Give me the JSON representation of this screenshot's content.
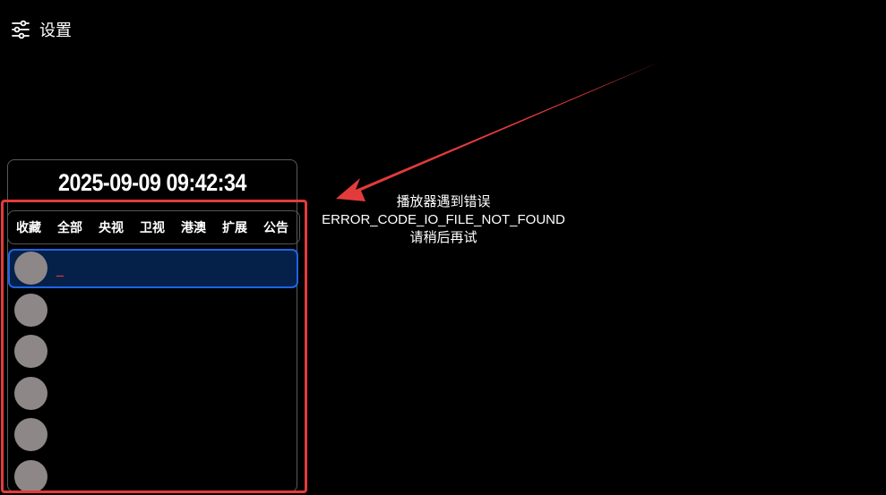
{
  "settings": {
    "icon": "sliders-icon",
    "label": "设置"
  },
  "clock": {
    "datetime": "2025-09-09 09:42:34"
  },
  "tabs": [
    {
      "label": "收藏"
    },
    {
      "label": "全部"
    },
    {
      "label": "央视"
    },
    {
      "label": "卫视"
    },
    {
      "label": "港澳"
    },
    {
      "label": "扩展"
    },
    {
      "label": "公告"
    }
  ],
  "channels": [
    {
      "name": "_",
      "selected": true
    },
    {
      "name": "",
      "selected": false
    },
    {
      "name": "",
      "selected": false
    },
    {
      "name": "",
      "selected": false
    },
    {
      "name": "",
      "selected": false
    },
    {
      "name": "",
      "selected": false
    }
  ],
  "error": {
    "line1": "播放器遇到错误",
    "line2": "ERROR_CODE_IO_FILE_NOT_FOUND",
    "line3": "请稍后再试"
  },
  "colors": {
    "background": "#000000",
    "selected_bg": "#05214a",
    "selected_border": "#1e64e6",
    "annotation_red": "#e33b3b",
    "avatar": "#8e8787"
  }
}
